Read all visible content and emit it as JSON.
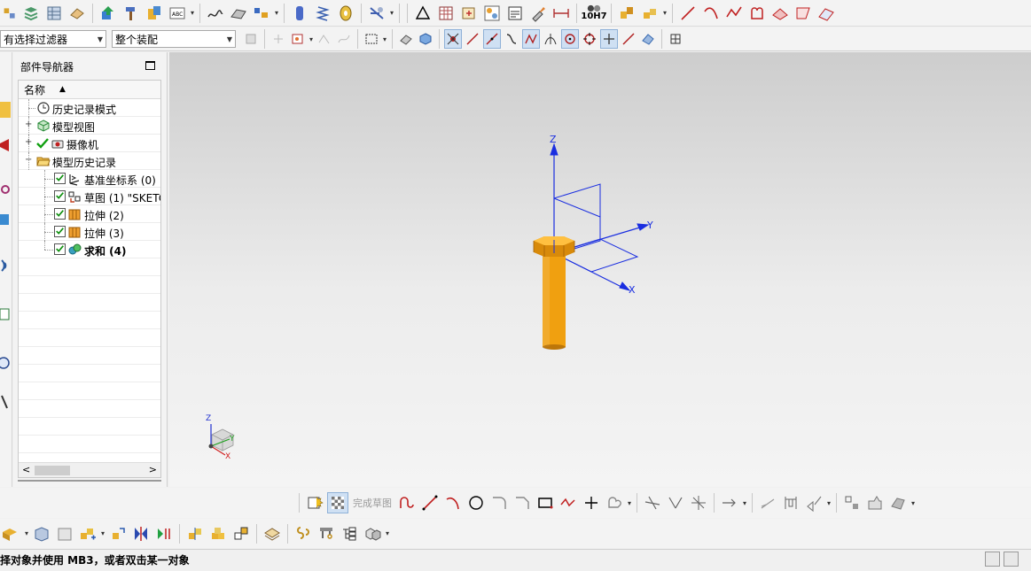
{
  "toolbar_filters": {
    "selection_filter": "有选择过滤器",
    "assembly_scope": "整个装配"
  },
  "toolbar_top": {
    "tolerance_label": "10H7"
  },
  "navigator": {
    "title": "部件导航器",
    "column_name": "名称",
    "items": [
      {
        "label": "历史记录模式",
        "icon": "history-clock-icon",
        "level": 0
      },
      {
        "label": "模型视图",
        "icon": "model-views-icon",
        "level": 0,
        "expandable": true
      },
      {
        "label": "摄像机",
        "icon": "camera-icon",
        "level": 0,
        "expandable": true,
        "checked": true
      },
      {
        "label": "模型历史记录",
        "icon": "folder-open-icon",
        "level": 0,
        "expanded": true
      },
      {
        "label": "基准坐标系 (0)",
        "icon": "datum-csys-icon",
        "level": 1,
        "checked": true
      },
      {
        "label": "草图 (1) \"SKETC",
        "icon": "sketch-icon",
        "level": 1,
        "checked": true
      },
      {
        "label": "拉伸 (2)",
        "icon": "extrude-icon",
        "level": 1,
        "checked": true
      },
      {
        "label": "拉伸 (3)",
        "icon": "extrude-icon",
        "level": 1,
        "checked": true
      },
      {
        "label": "求和 (4)",
        "icon": "unite-icon",
        "level": 1,
        "checked": true,
        "bold": true
      }
    ]
  },
  "viewport": {
    "axes": {
      "x": "X",
      "y": "Y",
      "z": "Z"
    },
    "triad": {
      "x": "X",
      "y": "Y",
      "z": "Z"
    },
    "part_color": "#f0a010",
    "csys_color": "#1a2ee0"
  },
  "sketch_toolbar": {
    "finish_sketch": "完成草图"
  },
  "status": {
    "prompt": "择对象并使用 MB3，或者双击某一对象"
  }
}
